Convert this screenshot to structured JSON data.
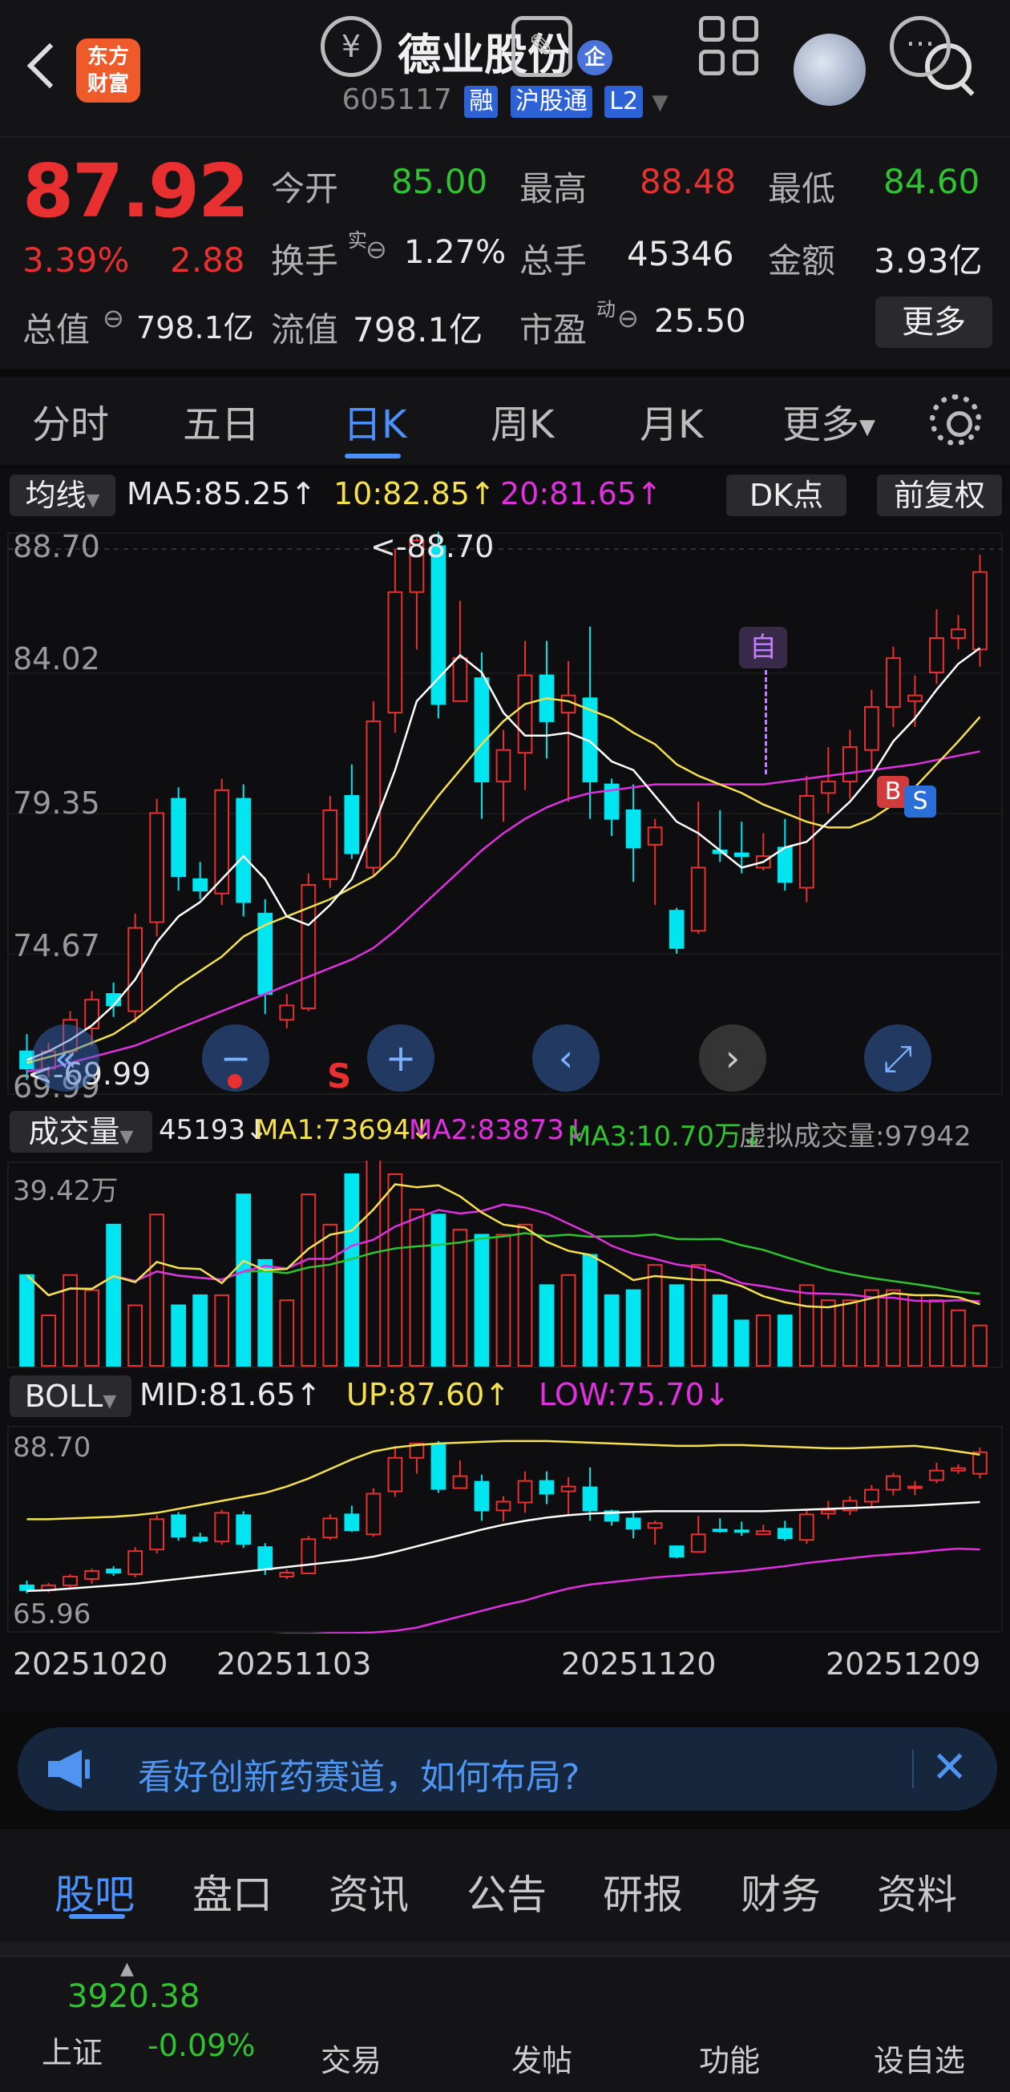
{
  "header": {
    "logo_text": "东方财富",
    "stock_name": "德业股份",
    "enterprise_badge": "企",
    "code": "605117",
    "tags": [
      "融",
      "沪股通",
      "L2"
    ]
  },
  "quote": {
    "price": "87.92",
    "change_pct": "3.39%",
    "change_amt": "2.88",
    "open_label": "今开",
    "open": "85.00",
    "high_label": "最高",
    "high": "88.48",
    "low_label": "最低",
    "low": "84.60",
    "turnover_label": "换手",
    "turnover_sup": "实",
    "turnover": "1.27%",
    "volume_label": "总手",
    "volume": "45346",
    "amount_label": "金额",
    "amount": "3.93亿",
    "mcap_label": "总值",
    "mcap": "798.1亿",
    "float_label": "流值",
    "float": "798.1亿",
    "pe_label": "市盈",
    "pe_sup": "动",
    "pe": "25.50",
    "more": "更多"
  },
  "tabs": [
    "分时",
    "五日",
    "日K",
    "周K",
    "月K",
    "更多"
  ],
  "active_tab": "日K",
  "ma_bar": {
    "selector": "均线",
    "ma5": "MA5:85.25↑",
    "ma10": "10:82.85↑",
    "ma20": "20:81.65↑",
    "dk": "DK点",
    "fq": "前复权"
  },
  "kline": {
    "y_labels": [
      "88.70",
      "84.02",
      "79.35",
      "74.67",
      "69.99"
    ],
    "max_label": "<-88.70",
    "min_label": "<-69.99",
    "mark_self": "自",
    "mark_b": "B",
    "mark_s": "S",
    "red_s": "S"
  },
  "volume_bar": {
    "selector": "成交量",
    "vol": "45193↓",
    "ma1": "MA1:73694↓",
    "ma2": "MA2:83873↓",
    "ma3": "MA3:10.70万↓",
    "virtual": "虚拟成交量:97942",
    "y_top": "39.42万"
  },
  "boll_bar": {
    "selector": "BOLL",
    "mid": "MID:81.65↑",
    "up": "UP:87.60↑",
    "low": "LOW:75.70↓",
    "y_top": "88.70",
    "y_bottom": "65.96"
  },
  "dates": [
    "20251020",
    "20251103",
    "20251120",
    "20251209"
  ],
  "banner": {
    "text": "看好创新药赛道，如何布局?"
  },
  "bottom_tabs": [
    "股吧",
    "盘口",
    "资讯",
    "公告",
    "研报",
    "财务",
    "资料"
  ],
  "footer": {
    "index_value": "3920.38",
    "index_name": "上证",
    "index_change": "-0.09%",
    "items": [
      "交易",
      "发帖",
      "功能",
      "设自选"
    ]
  },
  "colors": {
    "up": "#e83030",
    "down": "#00e5f0",
    "ma5": "#ffffff",
    "ma10": "#f5e050",
    "ma20": "#e030e0",
    "accent": "#4a90ff"
  },
  "chart_data": {
    "type": "candlestick",
    "ylim": [
      69.99,
      88.7
    ],
    "candles": [
      [
        71.2,
        70.6,
        71.8,
        70.2
      ],
      [
        70.6,
        71.2,
        71.5,
        70.3
      ],
      [
        71.2,
        72.3,
        72.6,
        70.9
      ],
      [
        72.0,
        73.0,
        73.3,
        71.4
      ],
      [
        73.2,
        72.8,
        73.6,
        72.4
      ],
      [
        72.6,
        75.5,
        76.0,
        72.2
      ],
      [
        75.7,
        79.5,
        80.0,
        75.2
      ],
      [
        80.0,
        77.3,
        80.4,
        76.8
      ],
      [
        77.2,
        76.8,
        77.8,
        76.5
      ],
      [
        76.7,
        80.3,
        80.7,
        76.3
      ],
      [
        80.0,
        76.4,
        80.5,
        75.9
      ],
      [
        76.0,
        73.2,
        76.5,
        72.5
      ],
      [
        72.3,
        72.8,
        73.2,
        72.0
      ],
      [
        72.7,
        77.0,
        77.4,
        72.6
      ],
      [
        77.2,
        79.6,
        80.1,
        76.9
      ],
      [
        80.1,
        78.1,
        81.2,
        77.9
      ],
      [
        77.6,
        82.7,
        83.4,
        77.3
      ],
      [
        83.0,
        87.2,
        88.7,
        82.3
      ],
      [
        87.2,
        89.0,
        89.1,
        85.2
      ],
      [
        88.8,
        83.3,
        89.3,
        82.8
      ],
      [
        83.4,
        84.9,
        86.9,
        84.1
      ],
      [
        84.2,
        80.6,
        85.1,
        79.3
      ],
      [
        80.6,
        81.7,
        82.4,
        79.2
      ],
      [
        81.6,
        84.3,
        85.5,
        80.3
      ],
      [
        84.3,
        82.7,
        85.5,
        81.4
      ],
      [
        83.0,
        83.6,
        84.8,
        79.9
      ],
      [
        83.5,
        80.6,
        86.0,
        79.3
      ],
      [
        80.5,
        79.3,
        80.7,
        78.7
      ],
      [
        79.6,
        78.3,
        80.5,
        77.1
      ],
      [
        78.4,
        79.0,
        79.3,
        76.3
      ],
      [
        76.1,
        74.8,
        76.2,
        74.6
      ],
      [
        75.4,
        77.6,
        79.9,
        75.3
      ],
      [
        78.2,
        78.1,
        79.6,
        77.8
      ],
      [
        78.1,
        78.0,
        79.2,
        77.4
      ],
      [
        77.6,
        78.0,
        78.8,
        77.5
      ],
      [
        78.3,
        77.1,
        79.3,
        76.8
      ],
      [
        76.9,
        80.1,
        80.8,
        76.4
      ],
      [
        80.2,
        80.6,
        81.8,
        79.5
      ],
      [
        80.6,
        81.8,
        82.4,
        80.0
      ],
      [
        81.7,
        83.2,
        83.8,
        81.0
      ],
      [
        83.2,
        84.9,
        85.3,
        82.5
      ],
      [
        83.4,
        83.6,
        84.3,
        82.5
      ],
      [
        84.4,
        85.6,
        86.6,
        84.0
      ],
      [
        85.6,
        85.9,
        86.4,
        85.2
      ],
      [
        85.2,
        87.9,
        88.5,
        84.6
      ]
    ],
    "ma5": [
      70.9,
      71.2,
      71.6,
      72.1,
      72.8,
      73.7,
      75.0,
      75.9,
      76.4,
      77.2,
      78.0,
      77.2,
      75.9,
      75.6,
      76.3,
      77.2,
      79.0,
      81.0,
      83.4,
      84.2,
      85.0,
      84.4,
      83.0,
      82.2,
      82.2,
      82.3,
      82.0,
      81.3,
      81.0,
      80.1,
      79.2,
      78.8,
      78.2,
      77.6,
      77.8,
      78.3,
      78.5,
      79.2,
      79.9,
      80.8,
      82.0,
      82.8,
      83.8,
      84.7,
      85.25
    ],
    "ma10": [
      70.8,
      71.0,
      71.2,
      71.5,
      71.8,
      72.3,
      72.9,
      73.5,
      74.0,
      74.5,
      75.2,
      75.6,
      75.9,
      76.2,
      76.5,
      76.9,
      77.3,
      78.0,
      79.1,
      80.1,
      81.0,
      81.9,
      82.7,
      83.3,
      83.5,
      83.4,
      83.1,
      82.8,
      82.3,
      81.9,
      81.2,
      80.8,
      80.5,
      80.2,
      79.8,
      79.5,
      79.2,
      79.0,
      79.0,
      79.3,
      79.8,
      80.4,
      81.2,
      82.0,
      82.85
    ],
    "ma20": [
      70.5,
      70.6,
      70.8,
      71.0,
      71.2,
      71.4,
      71.7,
      72.0,
      72.3,
      72.6,
      72.9,
      73.2,
      73.5,
      73.8,
      74.1,
      74.4,
      74.8,
      75.4,
      76.1,
      76.8,
      77.5,
      78.2,
      78.8,
      79.3,
      79.7,
      80.0,
      80.2,
      80.3,
      80.4,
      80.5,
      80.5,
      80.5,
      80.5,
      80.5,
      80.5,
      80.6,
      80.7,
      80.8,
      80.9,
      81.0,
      81.1,
      81.2,
      81.35,
      81.5,
      81.65
    ],
    "volume": [
      18,
      10,
      18,
      15,
      28,
      12,
      30,
      12,
      14,
      14,
      34,
      21,
      13,
      34,
      28,
      38,
      42,
      38,
      31,
      30,
      27,
      26,
      26,
      28,
      16,
      18,
      22,
      14,
      15,
      20,
      16,
      20,
      14,
      9,
      10,
      10,
      16,
      13,
      13,
      15,
      15,
      14,
      13,
      11,
      8
    ],
    "volume_ylim": [
      0,
      39.42
    ],
    "boll_up": [
      79.5,
      79.5,
      79.6,
      79.7,
      79.8,
      80.0,
      80.3,
      80.8,
      81.3,
      81.8,
      82.3,
      82.8,
      83.6,
      84.6,
      85.8,
      87.0,
      88.0,
      88.5,
      88.8,
      89.0,
      89.1,
      89.2,
      89.3,
      89.3,
      89.3,
      89.2,
      89.1,
      89.0,
      88.9,
      88.8,
      88.7,
      88.7,
      88.8,
      88.8,
      88.7,
      88.6,
      88.5,
      88.4,
      88.4,
      88.5,
      88.6,
      88.7,
      88.4,
      88.0,
      87.6
    ],
    "boll_mid": [
      70.5,
      70.6,
      70.8,
      71.0,
      71.2,
      71.4,
      71.7,
      72.0,
      72.3,
      72.6,
      72.9,
      73.2,
      73.5,
      73.8,
      74.1,
      74.4,
      74.8,
      75.4,
      76.1,
      76.8,
      77.5,
      78.2,
      78.8,
      79.3,
      79.7,
      80.0,
      80.2,
      80.3,
      80.4,
      80.5,
      80.5,
      80.5,
      80.5,
      80.5,
      80.5,
      80.6,
      80.7,
      80.8,
      80.9,
      81.0,
      81.1,
      81.2,
      81.35,
      81.5,
      81.65
    ],
    "boll_low": [
      62.6,
      62.7,
      62.9,
      63.2,
      63.5,
      63.9,
      64.3,
      64.6,
      64.8,
      64.9,
      64.9,
      65.0,
      65.1,
      65.1,
      65.2,
      65.2,
      65.3,
      65.5,
      65.9,
      66.6,
      67.3,
      68.0,
      68.7,
      69.3,
      70.1,
      70.8,
      71.3,
      71.6,
      71.9,
      72.2,
      72.4,
      72.6,
      72.8,
      73.0,
      73.3,
      73.6,
      74.0,
      74.3,
      74.6,
      74.9,
      75.1,
      75.3,
      75.6,
      75.8,
      75.7
    ],
    "boll_ylim": [
      65.96,
      90.5
    ]
  }
}
